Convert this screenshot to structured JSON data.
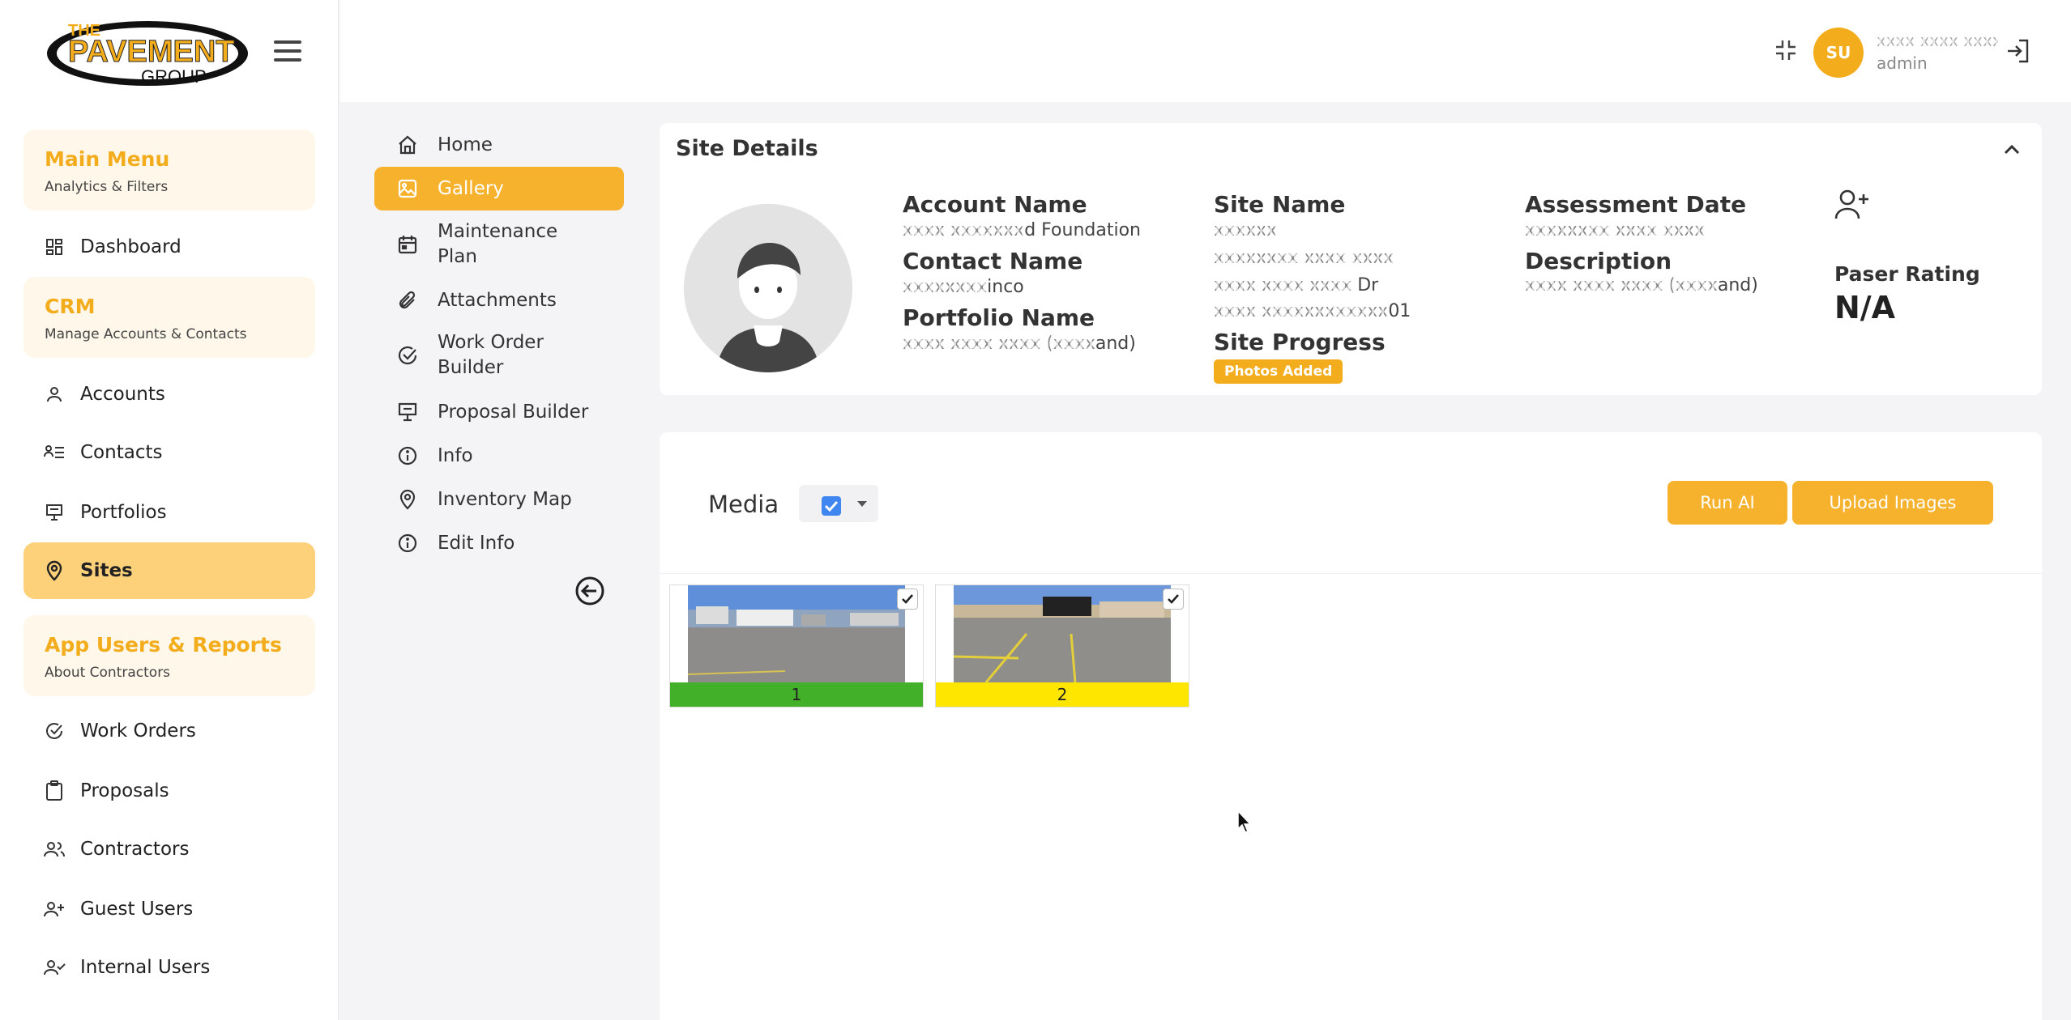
{
  "brand": {
    "logo_top": "THE",
    "logo_main": "PAVEMENT",
    "logo_bottom": "GROUP",
    "accent": "#f3ad1c"
  },
  "sidebar": {
    "sections": [
      {
        "title": "Main Menu",
        "subtitle": "Analytics & Filters"
      },
      {
        "title": "CRM",
        "subtitle": "Manage Accounts & Contacts"
      },
      {
        "title": "App Users & Reports",
        "subtitle": "About Contractors"
      }
    ],
    "items": {
      "dashboard": "Dashboard",
      "accounts": "Accounts",
      "contacts": "Contacts",
      "portfolios": "Portfolios",
      "sites": "Sites",
      "work_orders": "Work Orders",
      "proposals": "Proposals",
      "contractors": "Contractors",
      "guest_users": "Guest Users",
      "internal_users": "Internal Users"
    },
    "active": "sites"
  },
  "topbar": {
    "avatar_initials": "SU",
    "user_name": "xxxx xxxx xxxx",
    "user_role": "admin"
  },
  "submenu": {
    "home": "Home",
    "gallery": "Gallery",
    "maintenance_plan": "Maintenance Plan",
    "attachments": "Attachments",
    "work_order_builder": "Work Order Builder",
    "proposal_builder": "Proposal Builder",
    "info": "Info",
    "inventory_map": "Inventory Map",
    "edit_info": "Edit Info",
    "active": "gallery"
  },
  "site_details": {
    "title": "Site Details",
    "account_name_label": "Account Name",
    "account_name_redacted": "xxxx xxxxxxx",
    "account_name_suffix": "d Foundation",
    "contact_name_label": "Contact Name",
    "contact_name_redacted": "xxxxxxxx",
    "contact_name_suffix": "inco",
    "portfolio_name_label": "Portfolio Name",
    "portfolio_name_redacted": "xxxx xxxx xxxx (xxxx",
    "portfolio_name_suffix": "and)",
    "site_name_label": "Site Name",
    "site_name_line1": "xxxxxx",
    "site_name_line2": "xxxxxxxx xxxx xxxx",
    "site_name_line3_redacted": "xxxx xxxx xxxx",
    "site_name_line3_suffix": " Dr",
    "site_name_line4_redacted": "xxxx xxxxxxxxxxxx",
    "site_name_line4_suffix": "01",
    "site_progress_label": "Site Progress",
    "site_progress_value": "Photos Added",
    "assessment_date_label": "Assessment Date",
    "assessment_date_value": "xxxxxxxx xxxx xxxx",
    "description_label": "Description",
    "description_redacted": "xxxx xxxx xxxx (xxxx",
    "description_suffix": "and)",
    "paser_rating_label": "Paser Rating",
    "paser_rating_value": "N/A"
  },
  "media": {
    "title": "Media",
    "run_ai_label": "Run AI",
    "upload_label": "Upload Images",
    "images": [
      {
        "label": "1",
        "status_color": "#43b02a",
        "checked": true
      },
      {
        "label": "2",
        "status_color": "#ffe600",
        "checked": true
      }
    ]
  }
}
